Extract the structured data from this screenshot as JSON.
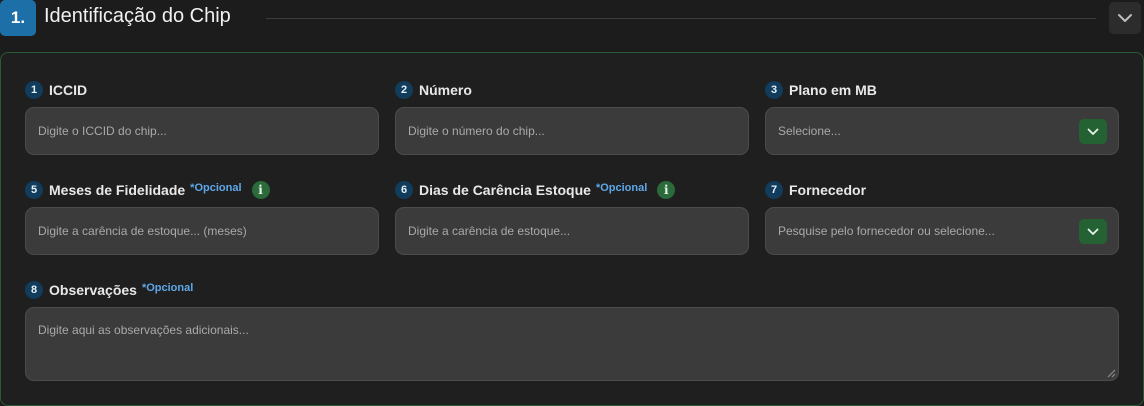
{
  "section": {
    "step": "1.",
    "title": "Identificação do Chip",
    "collapse_icon": "chevron-down-icon"
  },
  "fields": {
    "iccid": {
      "number": "1",
      "label": "ICCID",
      "placeholder": "Digite o ICCID do chip..."
    },
    "numero": {
      "number": "2",
      "label": "Número",
      "placeholder": "Digite o número do chip..."
    },
    "plano": {
      "number": "3",
      "label": "Plano em MB",
      "placeholder": "Selecione..."
    },
    "fidelidade": {
      "number": "5",
      "label": "Meses de Fidelidade",
      "optional": "*Opcional",
      "placeholder": "Digite a carência de estoque... (meses)",
      "info_icon": "i"
    },
    "carencia": {
      "number": "6",
      "label": "Dias de Carência Estoque",
      "optional": "*Opcional",
      "placeholder": "Digite a carência de estoque...",
      "info_icon": "i"
    },
    "fornecedor": {
      "number": "7",
      "label": "Fornecedor",
      "placeholder": "Pesquise pelo fornecedor ou selecione..."
    },
    "observacoes": {
      "number": "8",
      "label": "Observações",
      "optional": "*Opcional",
      "placeholder": "Digite aqui as observações adicionais..."
    }
  },
  "colors": {
    "step_badge": "#1d6fa8",
    "number_badge": "#123c5b",
    "optional_text": "#5ea8ea",
    "select_button": "#246133",
    "card_border": "#2a5a36"
  }
}
